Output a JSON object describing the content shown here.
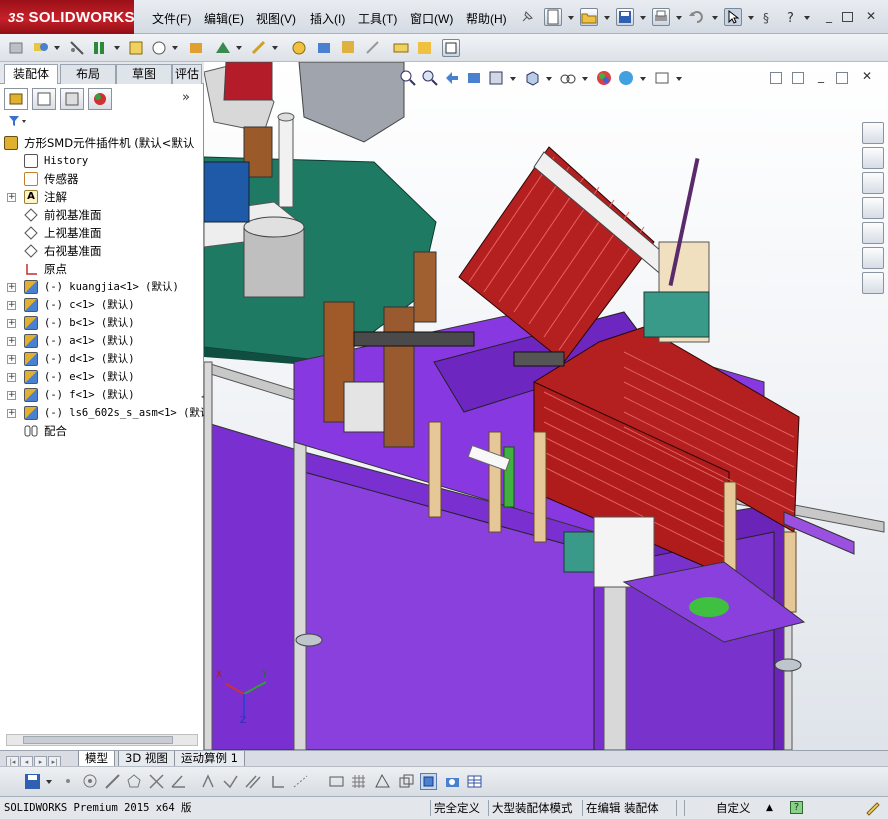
{
  "app": {
    "brand": "SOLIDWORKS",
    "brand_prefix": "3S"
  },
  "menu": [
    "文件(F)",
    "编辑(E)",
    "视图(V)",
    "插入(I)",
    "工具(T)",
    "窗口(W)",
    "帮助(H)"
  ],
  "command_tabs": [
    "装配体",
    "布局",
    "草图",
    "评估"
  ],
  "feature_manager": {
    "filter_icon": "funnel-icon",
    "tree": [
      {
        "label": "方形SMD元件插件机  (默认<默认",
        "icon": "assembly-icon",
        "expand": false,
        "indent": 0
      },
      {
        "label": "History",
        "icon": "history-icon",
        "expand": false,
        "indent": 1,
        "mono": true
      },
      {
        "label": "传感器",
        "icon": "sensor-icon",
        "expand": false,
        "indent": 1
      },
      {
        "label": "注解",
        "icon": "annotation-icon",
        "expand": true,
        "indent": 1
      },
      {
        "label": "前视基准面",
        "icon": "plane-icon",
        "expand": false,
        "indent": 1
      },
      {
        "label": "上视基准面",
        "icon": "plane-icon",
        "expand": false,
        "indent": 1
      },
      {
        "label": "右视基准面",
        "icon": "plane-icon",
        "expand": false,
        "indent": 1
      },
      {
        "label": "原点",
        "icon": "origin-icon",
        "expand": false,
        "indent": 1
      },
      {
        "label": "(-) kuangjia<1> (默认)",
        "icon": "subassembly-icon",
        "expand": true,
        "indent": 1,
        "mono": true
      },
      {
        "label": "(-) c<1> (默认)",
        "icon": "subassembly-icon",
        "expand": true,
        "indent": 1,
        "mono": true
      },
      {
        "label": "(-) b<1> (默认)",
        "icon": "subassembly-icon",
        "expand": true,
        "indent": 1,
        "mono": true
      },
      {
        "label": "(-) a<1> (默认)",
        "icon": "subassembly-icon",
        "expand": true,
        "indent": 1,
        "mono": true
      },
      {
        "label": "(-) d<1> (默认)",
        "icon": "subassembly-icon",
        "expand": true,
        "indent": 1,
        "mono": true
      },
      {
        "label": "(-) e<1> (默认)",
        "icon": "subassembly-icon",
        "expand": true,
        "indent": 1,
        "mono": true
      },
      {
        "label": "(-) f<1> (默认)",
        "icon": "subassembly-icon",
        "expand": true,
        "indent": 1,
        "mono": true
      },
      {
        "label": "(-) ls6_602s_s_asm<1> (默认",
        "icon": "subassembly-icon",
        "expand": true,
        "indent": 1,
        "mono": true
      },
      {
        "label": "配合",
        "icon": "mates-icon",
        "expand": false,
        "indent": 1
      }
    ]
  },
  "viewport": {
    "triad": {
      "x": "X",
      "y": "Y",
      "z": "Z"
    }
  },
  "bottom_tabs": [
    "模型",
    "3D 视图",
    "运动算例 1"
  ],
  "statusbar": {
    "product": "SOLIDWORKS Premium 2015 x64 版",
    "definition": "完全定义",
    "mode": "大型装配体模式",
    "editing": "在编辑 装配体",
    "units": "自定义"
  }
}
